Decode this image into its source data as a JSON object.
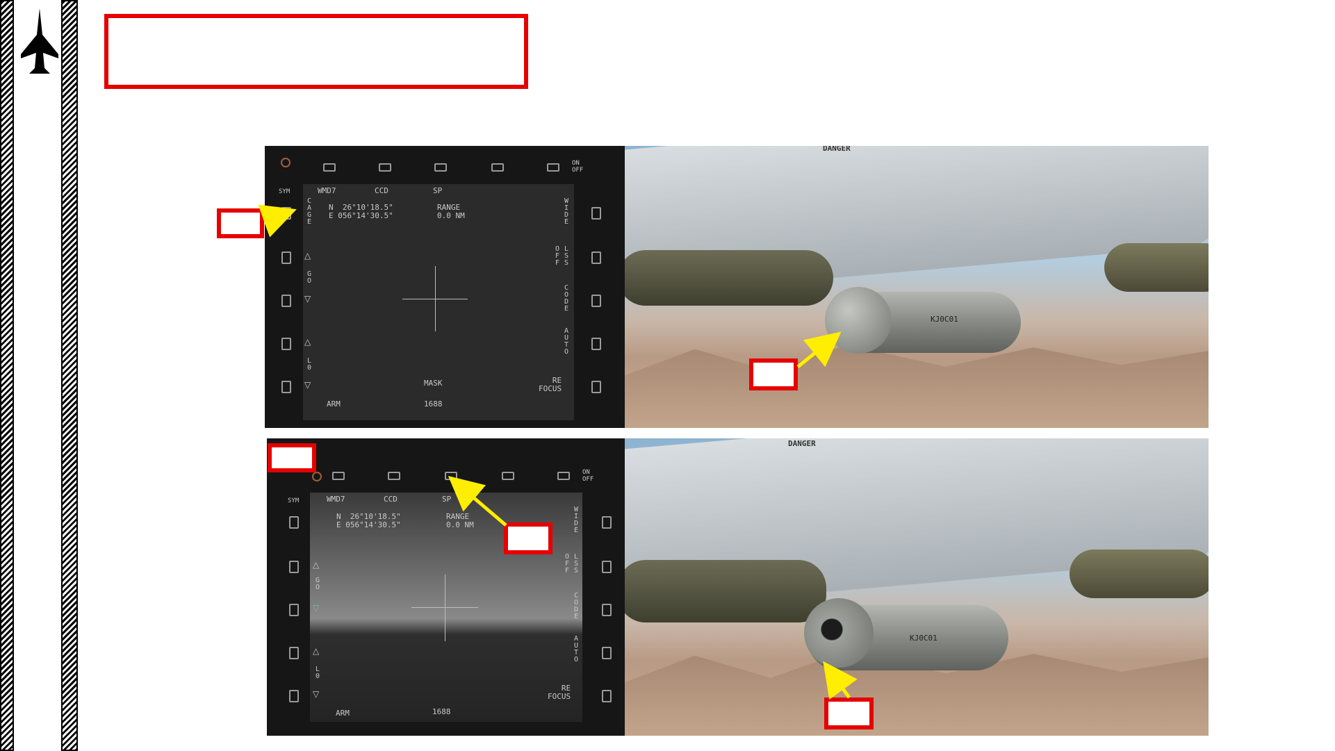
{
  "page": {
    "title_callout": "",
    "bottom_caption": ""
  },
  "top_panel": {
    "mfd": {
      "top_labels": [
        "WMD7",
        "CCD",
        "SP"
      ],
      "on_off": "ON\nOFF",
      "sym": "SYM",
      "coord_n": "N  26°10'18.5\"",
      "coord_e": "E 056°14'30.5\"",
      "range_label": "RANGE",
      "range_value": "0.0 NM",
      "left_vertical": [
        "CAGE",
        "GO",
        "L0"
      ],
      "right_vertical": [
        "WIDE",
        "OFF",
        "LSS",
        "CODE",
        "AUTO"
      ],
      "refocus": "RE\nFOCUS",
      "mask": "MASK",
      "arm": "ARM",
      "code_value": "1688"
    },
    "callouts": [
      "",
      ""
    ]
  },
  "bottom_panel": {
    "mfd": {
      "top_labels": [
        "WMD7",
        "CCD",
        "SP"
      ],
      "on_off": "ON\nOFF",
      "sym": "SYM",
      "coord_n": "N  26°10'18.5\"",
      "coord_e": "E 056°14'30.5\"",
      "range_label": "RANGE",
      "range_value": "0.0 NM",
      "left_vertical": [
        "GO",
        "L0"
      ],
      "right_vertical": [
        "WIDE",
        "OFF",
        "LSS",
        "CODE",
        "AUTO"
      ],
      "refocus": "RE\nFOCUS",
      "arm": "ARM",
      "code_value": "1688"
    },
    "callouts": [
      "",
      "",
      ""
    ]
  },
  "photo": {
    "warning_stencil": "DANGER",
    "pod_serial": "KJ0C01"
  },
  "colors": {
    "callout_border": "#e60000",
    "arrow": "#ffee00"
  }
}
